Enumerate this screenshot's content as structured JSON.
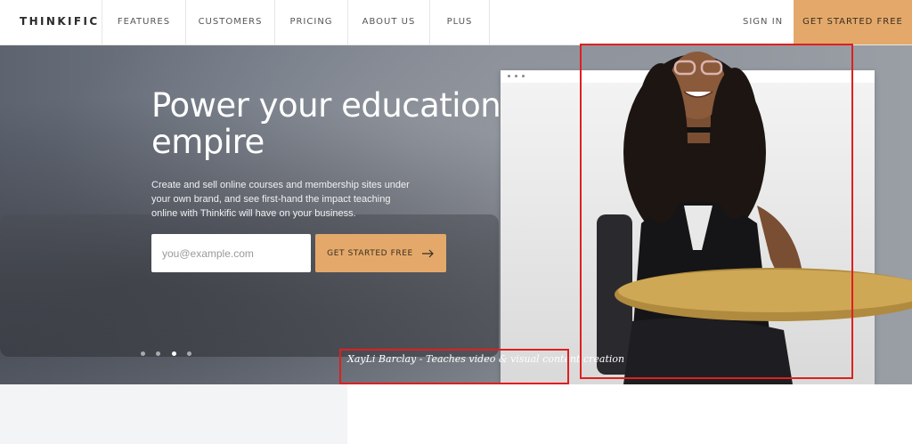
{
  "nav": {
    "logo": "THINKIFIC",
    "items": [
      {
        "label": "FEATURES"
      },
      {
        "label": "CUSTOMERS"
      },
      {
        "label": "PRICING"
      },
      {
        "label": "ABOUT US"
      },
      {
        "label": "PLUS"
      }
    ],
    "sign_in": "SIGN IN",
    "cta": "GET STARTED FREE"
  },
  "hero": {
    "title": "Power your education empire",
    "description": "Create and sell online courses and membership sites under your own brand, and see first-hand the impact teaching online with Thinkific will have on your business.",
    "email_placeholder": "you@example.com",
    "cta_label": "GET STARTED FREE",
    "cta_icon": "arrow-right-icon",
    "carousel": {
      "count": 4,
      "active_index": 2
    },
    "caption": "XayLi Barclay - Teaches video & visual content creation"
  },
  "colors": {
    "accent": "#e4a96a",
    "annotation": "#e01f1f"
  }
}
